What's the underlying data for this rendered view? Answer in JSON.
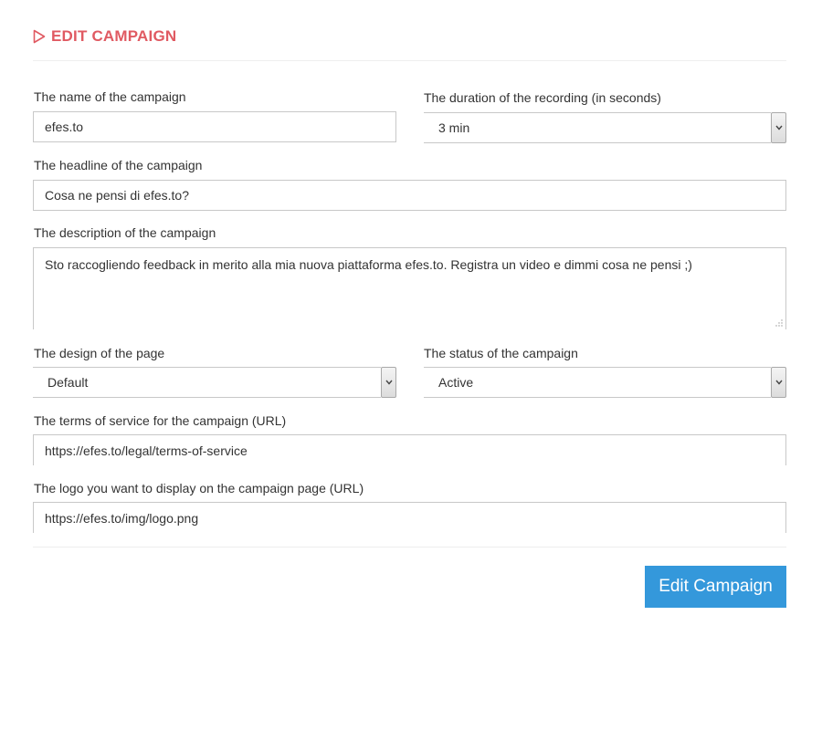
{
  "header": {
    "title": "EDIT CAMPAIGN",
    "icon": "play-outline-icon",
    "accent_color": "#e05a62"
  },
  "form": {
    "name": {
      "label": "The name of the campaign",
      "value": "efes.to"
    },
    "duration": {
      "label": "The duration of the recording (in seconds)",
      "selected": "3 min"
    },
    "headline": {
      "label": "The headline of the campaign",
      "value": "Cosa ne pensi di efes.to?"
    },
    "description": {
      "label": "The description of the campaign",
      "value": "Sto raccogliendo feedback in merito alla mia nuova piattaforma efes.to. Registra un video e dimmi cosa ne pensi ;)"
    },
    "design": {
      "label": "The design of the page",
      "selected": "Default"
    },
    "status": {
      "label": "The status of the campaign",
      "selected": "Active"
    },
    "terms": {
      "label": "The terms of service for the campaign (URL)",
      "value": "https://efes.to/legal/terms-of-service"
    },
    "logo": {
      "label": "The logo you want to display on the campaign page (URL)",
      "value": "https://efes.to/img/logo.png"
    }
  },
  "actions": {
    "submit_label": "Edit Campaign",
    "submit_color": "#3498db"
  }
}
